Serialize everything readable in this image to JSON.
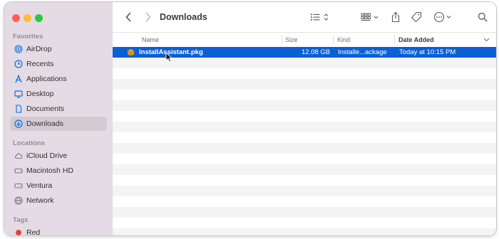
{
  "sidebar": {
    "sections": [
      {
        "header": "Favorites",
        "items": [
          {
            "label": "AirDrop",
            "icon": "airdrop-icon"
          },
          {
            "label": "Recents",
            "icon": "clock-icon"
          },
          {
            "label": "Applications",
            "icon": "applications-icon"
          },
          {
            "label": "Desktop",
            "icon": "desktop-icon"
          },
          {
            "label": "Documents",
            "icon": "document-icon"
          },
          {
            "label": "Downloads",
            "icon": "downloads-icon",
            "selected": true
          }
        ]
      },
      {
        "header": "Locations",
        "items": [
          {
            "label": "iCloud Drive",
            "icon": "cloud-icon"
          },
          {
            "label": "Macintosh HD",
            "icon": "disk-icon"
          },
          {
            "label": "Ventura",
            "icon": "disk-icon"
          },
          {
            "label": "Network",
            "icon": "globe-icon"
          }
        ]
      },
      {
        "header": "Tags",
        "items": [
          {
            "label": "Red",
            "icon": "tag-dot-icon",
            "color": "#e0443e"
          }
        ]
      }
    ]
  },
  "toolbar": {
    "title": "Downloads",
    "icons": [
      "back-icon",
      "forward-icon",
      "list-view-icon",
      "grid-view-icon",
      "share-icon",
      "tag-icon",
      "more-icon",
      "search-icon"
    ]
  },
  "columns": {
    "name": "Name",
    "size": "Size",
    "kind": "Kind",
    "date_added": "Date Added"
  },
  "files": [
    {
      "name": "InstallAssistant.pkg",
      "size": "12.08 GB",
      "kind": "Installe...ackage",
      "date_added": "Today at 10:15 PM",
      "selected": true
    }
  ],
  "colors": {
    "selection": "#0a5fd6",
    "sidebar_bg": "#e5dbe4",
    "close": "#fe5f57",
    "minimize": "#febc2e",
    "zoom": "#28c840",
    "accent_icon": "#0a6ce0"
  }
}
